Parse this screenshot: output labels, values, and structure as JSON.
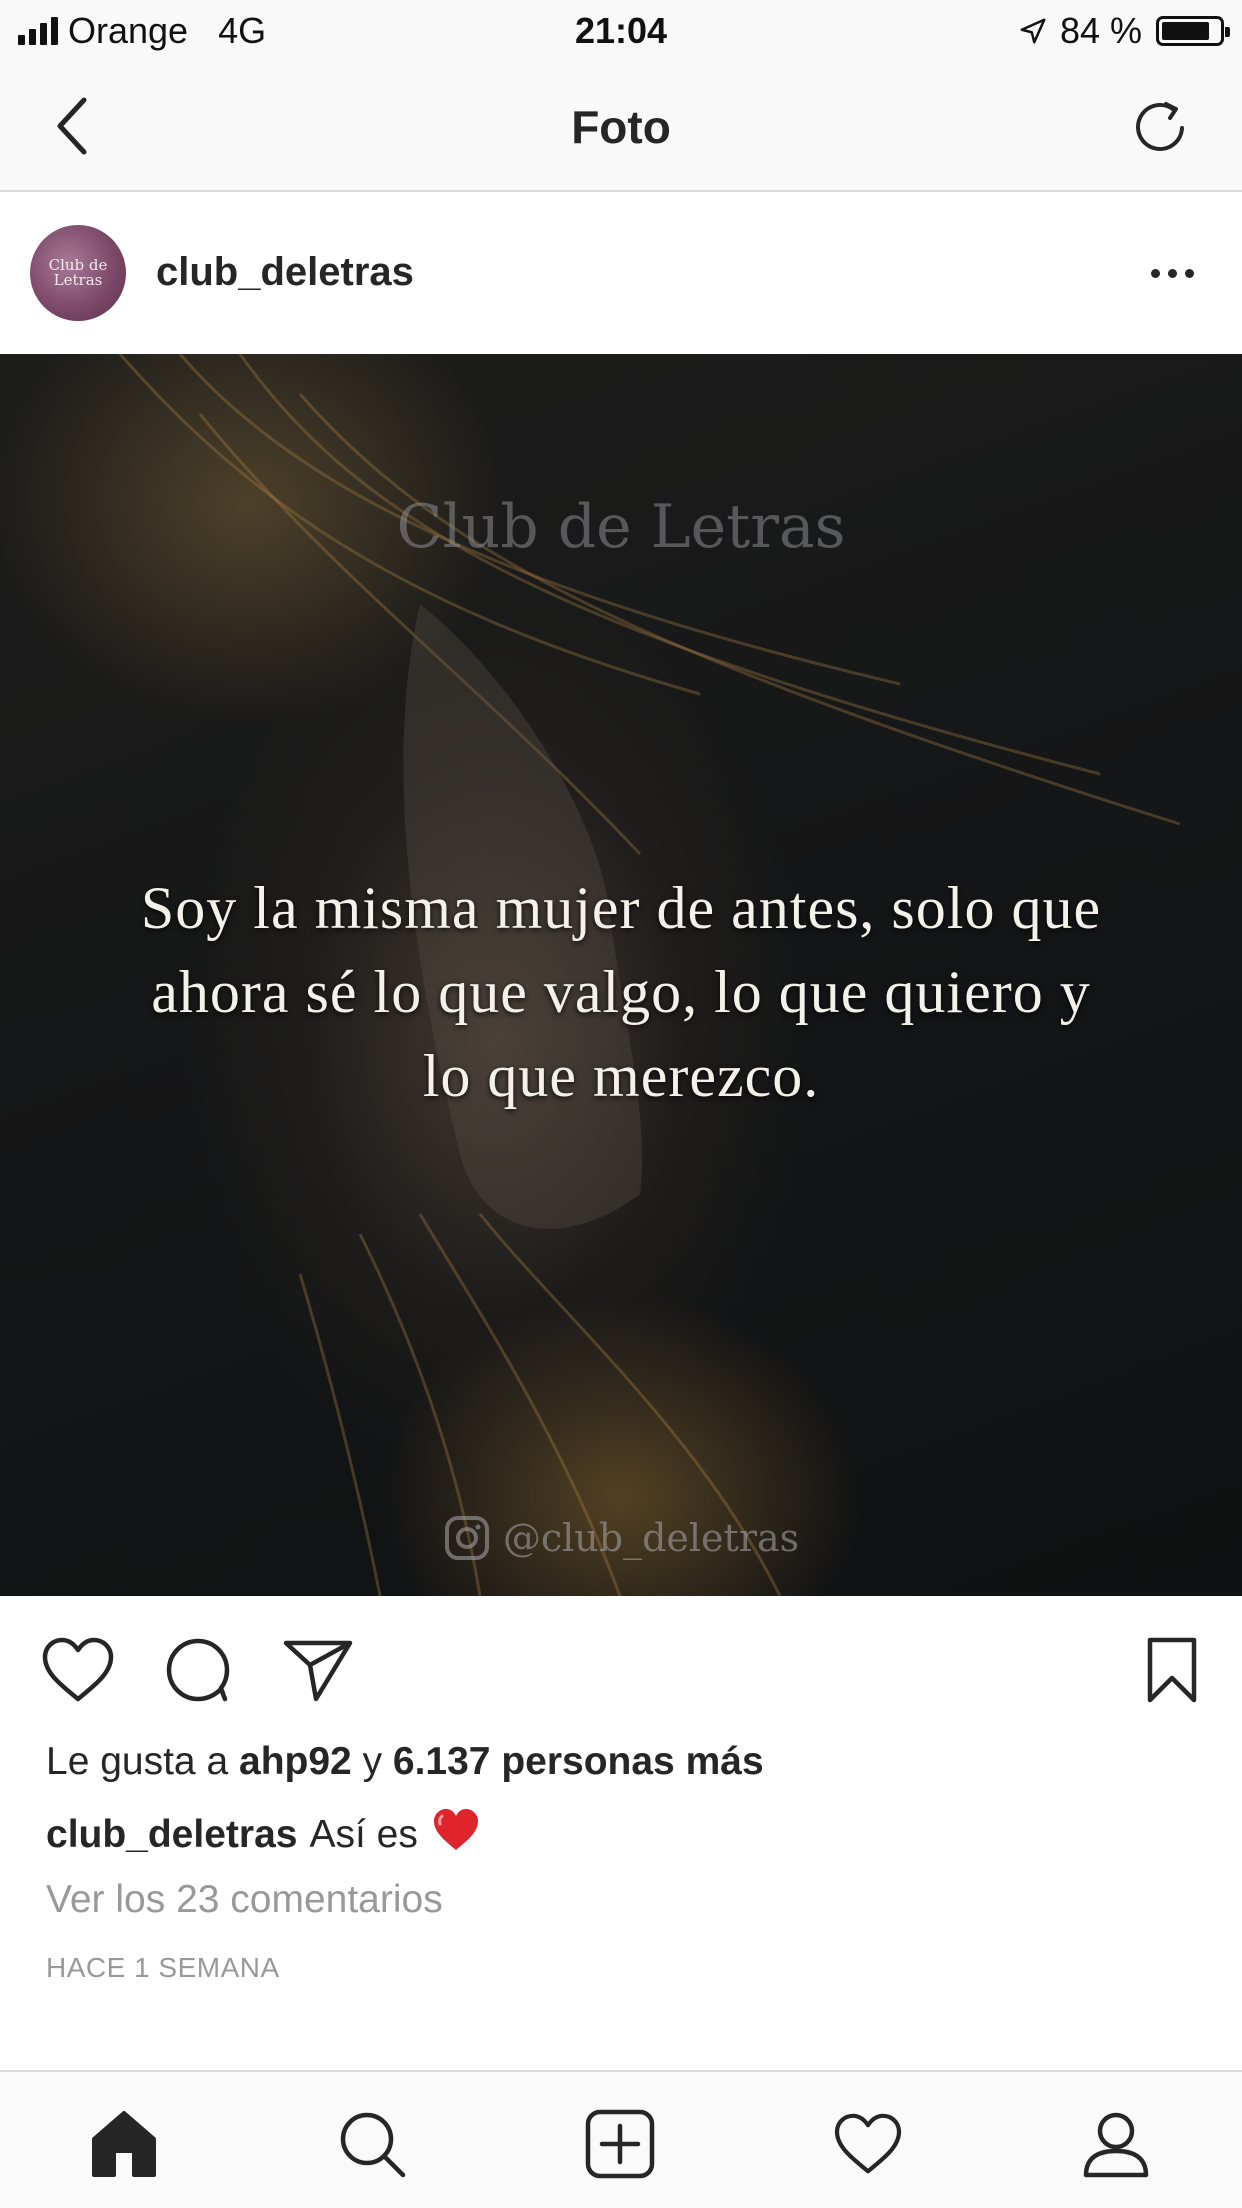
{
  "status_bar": {
    "carrier": "Orange",
    "network": "4G",
    "time": "21:04",
    "battery_percent": "84 %",
    "battery_level": 0.84,
    "signal_bars": 4
  },
  "nav": {
    "title": "Foto",
    "back_icon": "chevron-left-icon",
    "refresh_icon": "refresh-icon"
  },
  "post": {
    "username": "club_deletras",
    "avatar_text": "Club de Letras",
    "image": {
      "watermark_top": "Club de Letras",
      "quote": "Soy la misma mujer de antes, solo que ahora sé lo que valgo, lo que quiero y lo que merezco.",
      "watermark_bottom": "@club_deletras"
    },
    "likes_prefix": "Le gusta a",
    "likes_user": "ahp92",
    "likes_conj": "y",
    "likes_others": "6.137 personas más",
    "caption_user": "club_deletras",
    "caption_text": "Así es",
    "caption_emoji": "❤️",
    "view_comments": "Ver los 23 comentarios",
    "timestamp": "HACE 1 SEMANA"
  },
  "tab_bar": {
    "items": [
      "home-icon",
      "search-icon",
      "add-post-icon",
      "heart-icon",
      "profile-icon"
    ]
  },
  "colors": {
    "text": "#262626",
    "secondary_text": "#999999",
    "divider": "#dbdbdb",
    "bar_background": "#f9f9f9",
    "emoji_heart": "#e0242c"
  }
}
